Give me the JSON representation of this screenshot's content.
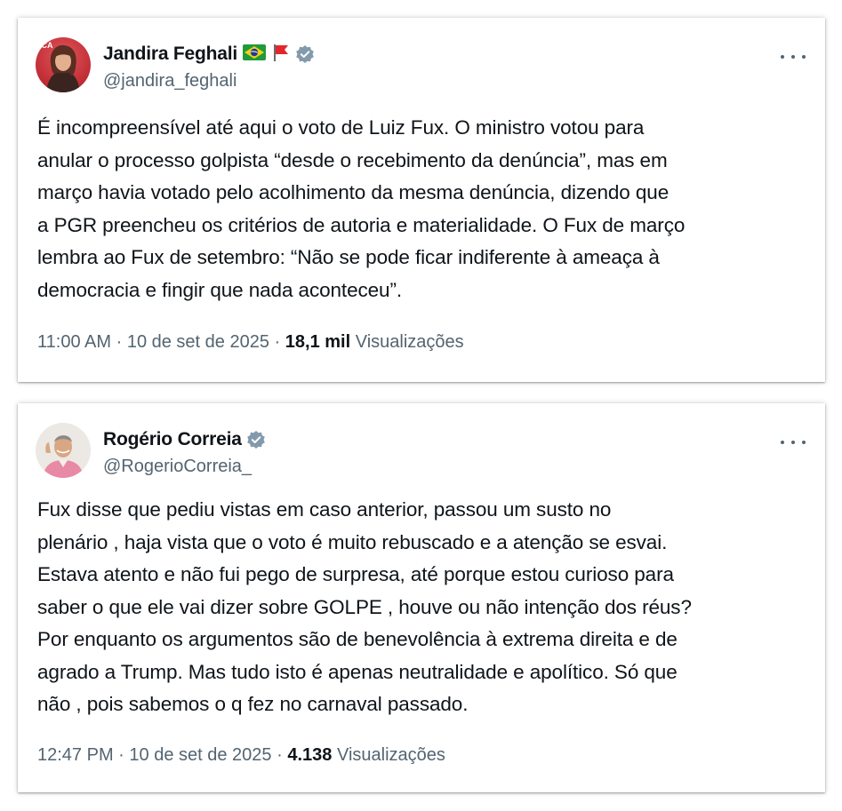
{
  "tweets": [
    {
      "display_name": "Jandira Feghali",
      "handle": "@jandira_feghali",
      "flag_emoji_1": "brazil-flag-icon",
      "flag_emoji_2": "red-flag-icon",
      "verified": true,
      "text": "É incompreensível até aqui o voto de Luiz Fux. O ministro votou para\nanular o processo golpista “desde o recebimento da denúncia”, mas em\nmarço havia votado pelo acolhimento da mesma denúncia, dizendo que\na PGR preencheu os critérios de autoria e materialidade. O Fux de março\nlembra ao Fux de setembro: “Não se pode ficar indiferente à ameaça à\ndemocracia e fingir que nada aconteceu”.",
      "time": "11:00 AM",
      "date": "10 de set de 2025",
      "separator": "·",
      "views_count": "18,1 mil",
      "views_label": "Visualizações"
    },
    {
      "display_name": "Rogério Correia",
      "handle": "@RogerioCorreia_",
      "verified": true,
      "text": "Fux disse que pediu vistas em caso anterior, passou um susto no\nplenário , haja vista que o voto é muito rebuscado e a atenção se esvai.\nEstava atento e não fui pego de surpresa, até porque estou curioso para\nsaber o que ele vai dizer sobre GOLPE , houve ou não intenção dos réus?\nPor enquanto os argumentos são de benevolência à extrema direita e de\nagrado a Trump. Mas tudo isto é apenas neutralidade e apolítico. Só que\nnão , pois sabemos o q fez no carnaval passado.",
      "time": "12:47 PM",
      "date": "10 de set de 2025",
      "separator": "·",
      "views_count": "4.138",
      "views_label": "Visualizações"
    }
  ],
  "colors": {
    "text_primary": "#0f1419",
    "text_secondary": "#536471",
    "verified_blue": "#829aab",
    "background": "#ffffff"
  },
  "icons": {
    "more": "more-options-icon",
    "verified": "verified-badge-icon"
  }
}
